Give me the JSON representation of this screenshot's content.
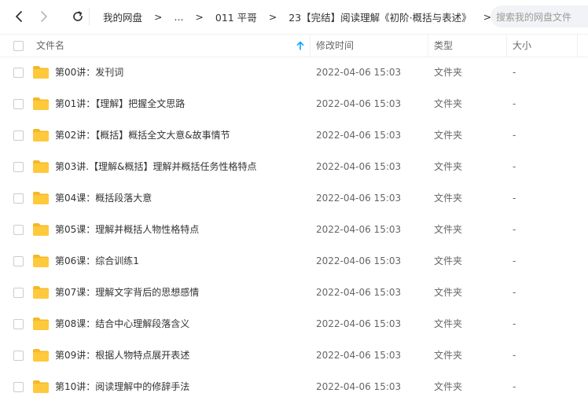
{
  "nav": {
    "breadcrumb": [
      "我的网盘",
      "...",
      "011 平哥",
      "23【完结】阅读理解《初阶·概括与表述》"
    ],
    "separator": ">"
  },
  "search": {
    "placeholder": "搜索我的网盘文件"
  },
  "table": {
    "headers": {
      "name": "文件名",
      "modified": "修改时间",
      "type": "类型",
      "size": "大小"
    },
    "rows": [
      {
        "name": "第00讲：发刊词",
        "modified": "2022-04-06 15:03",
        "type": "文件夹",
        "size": "-"
      },
      {
        "name": "第01讲：【理解】把握全文思路",
        "modified": "2022-04-06 15:03",
        "type": "文件夹",
        "size": "-"
      },
      {
        "name": "第02讲：【概括】概括全文大意&故事情节",
        "modified": "2022-04-06 15:03",
        "type": "文件夹",
        "size": "-"
      },
      {
        "name": "第03讲.【理解&概括】理解并概括任务性格特点",
        "modified": "2022-04-06 15:03",
        "type": "文件夹",
        "size": "-"
      },
      {
        "name": "第04课：概括段落大意",
        "modified": "2022-04-06 15:03",
        "type": "文件夹",
        "size": "-"
      },
      {
        "name": "第05课：理解并概括人物性格特点",
        "modified": "2022-04-06 15:03",
        "type": "文件夹",
        "size": "-"
      },
      {
        "name": "第06课：综合训练1",
        "modified": "2022-04-06 15:03",
        "type": "文件夹",
        "size": "-"
      },
      {
        "name": "第07课：理解文字背后的思想感情",
        "modified": "2022-04-06 15:03",
        "type": "文件夹",
        "size": "-"
      },
      {
        "name": "第08课：结合中心理解段落含义",
        "modified": "2022-04-06 15:03",
        "type": "文件夹",
        "size": "-"
      },
      {
        "name": "第09讲：根据人物特点展开表述",
        "modified": "2022-04-06 15:03",
        "type": "文件夹",
        "size": "-"
      },
      {
        "name": "第10讲：阅读理解中的修辞手法",
        "modified": "2022-04-06 15:03",
        "type": "文件夹",
        "size": "-"
      }
    ]
  },
  "colors": {
    "folder": "#ffc93c",
    "folder_tab": "#f5b829",
    "sort_arrow": "#06a7ff"
  }
}
